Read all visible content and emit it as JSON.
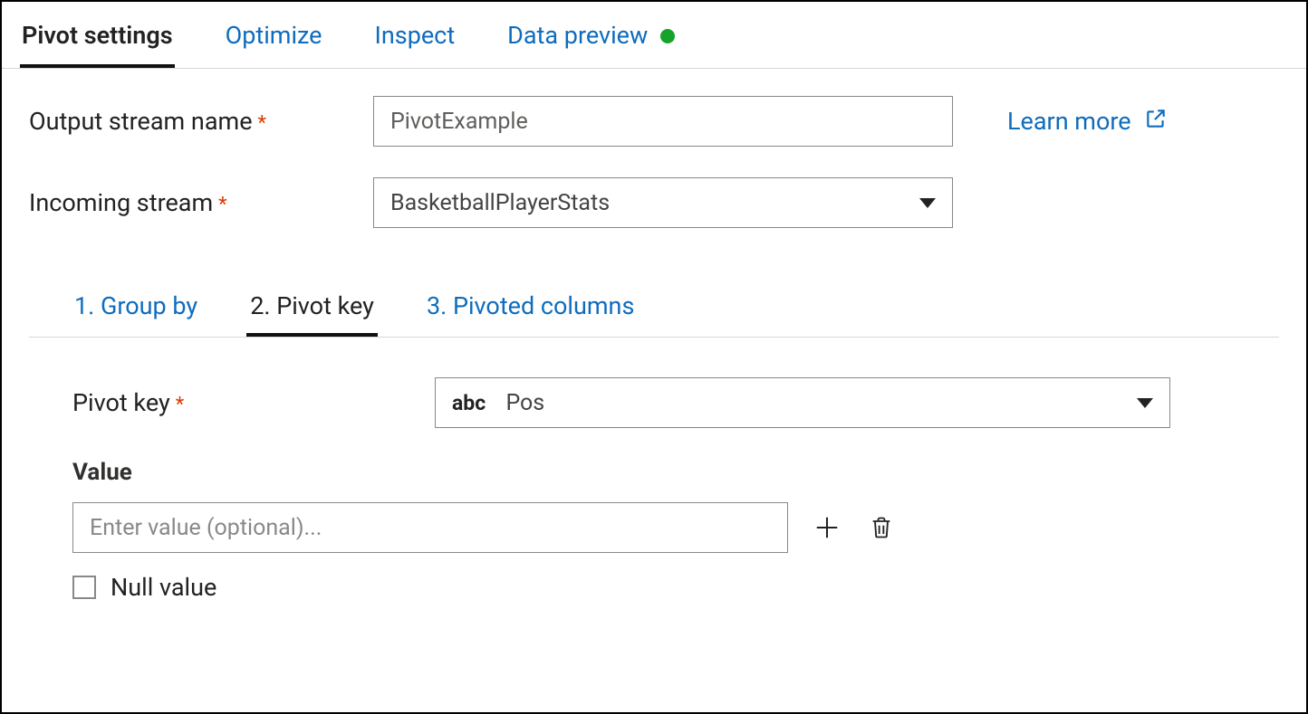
{
  "colors": {
    "link": "#0F6CBD",
    "status_ok": "#17a32a",
    "required": "#d83b01"
  },
  "topTabs": {
    "items": [
      {
        "label": "Pivot settings"
      },
      {
        "label": "Optimize"
      },
      {
        "label": "Inspect"
      },
      {
        "label": "Data preview"
      }
    ],
    "activeIndex": 0,
    "dataPreviewStatus": "ok"
  },
  "learnMore": {
    "label": "Learn more"
  },
  "form": {
    "outputStreamName": {
      "label": "Output stream name",
      "required": true,
      "value": "PivotExample"
    },
    "incomingStream": {
      "label": "Incoming stream",
      "required": true,
      "selected": "BasketballPlayerStats"
    }
  },
  "stepTabs": {
    "items": [
      {
        "label": "1. Group by"
      },
      {
        "label": "2. Pivot key"
      },
      {
        "label": "3. Pivoted columns"
      }
    ],
    "activeIndex": 1
  },
  "pivotKey": {
    "label": "Pivot key",
    "required": true,
    "typePrefix": "abc",
    "selected": "Pos"
  },
  "valueSection": {
    "heading": "Value",
    "placeholder": "Enter value (optional)...",
    "value": "",
    "nullValueLabel": "Null value",
    "nullValueChecked": false
  },
  "icons": {
    "externalLink": "external-link-icon",
    "caretDown": "caret-down-icon",
    "plus": "plus-icon",
    "trash": "trash-icon"
  }
}
